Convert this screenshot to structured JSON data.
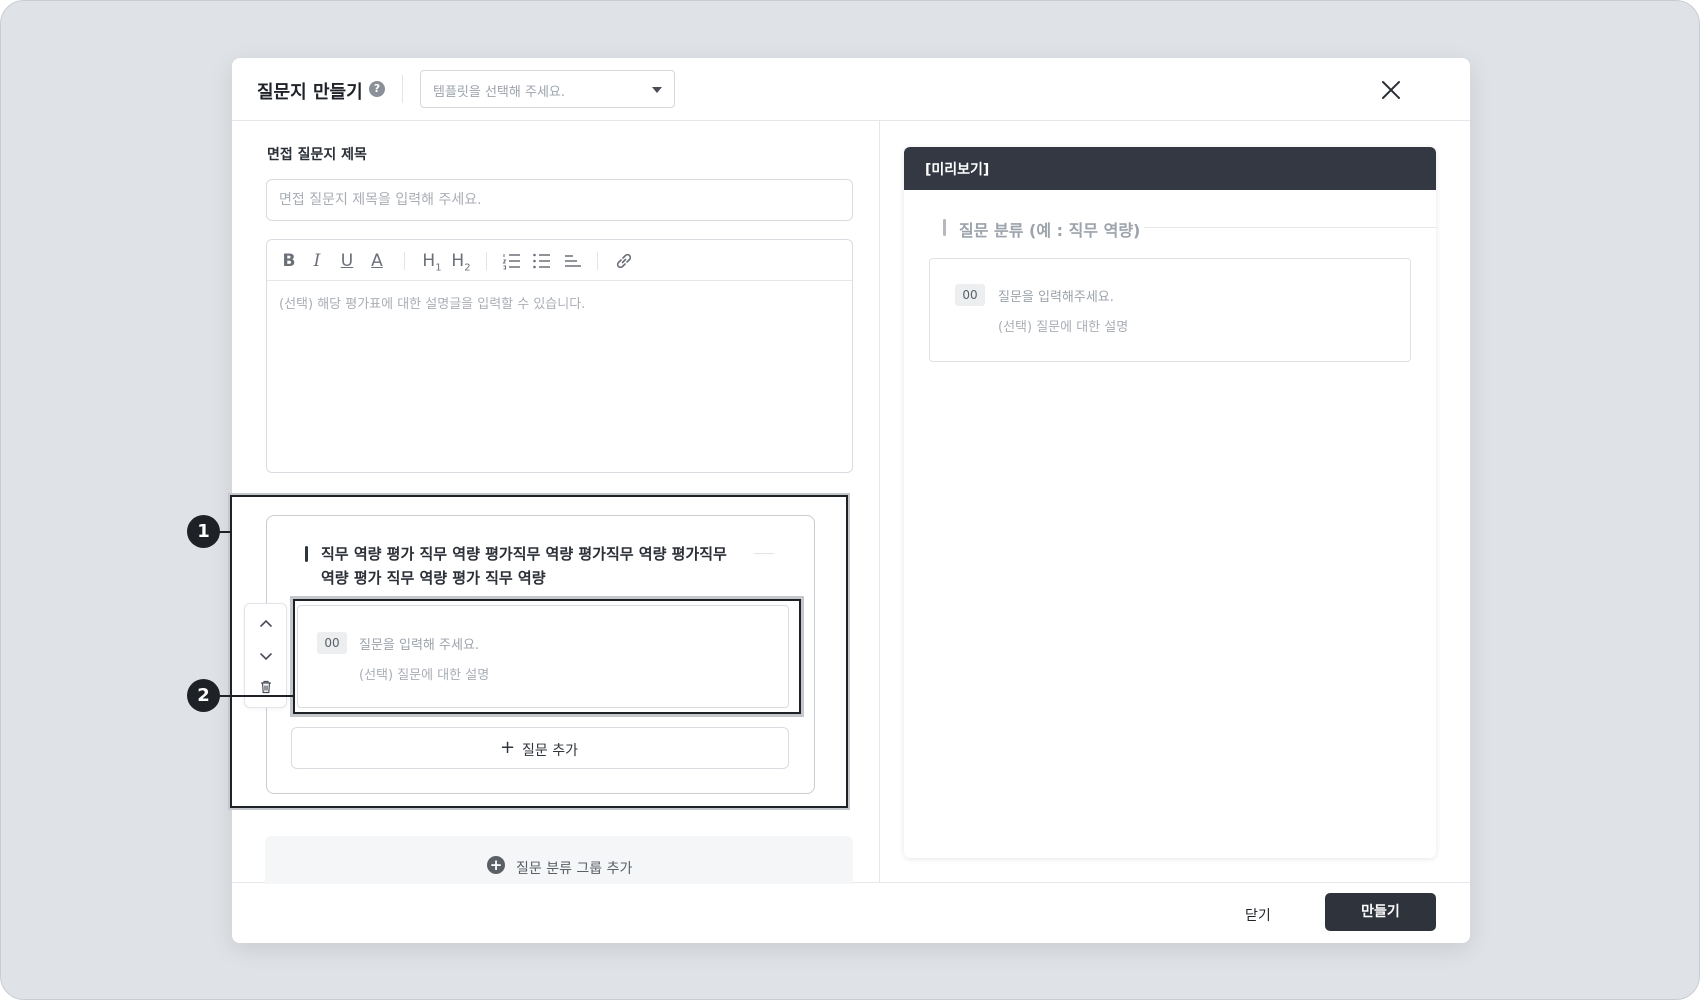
{
  "modal": {
    "title": "질문지 만들기",
    "help_icon": "?",
    "template_placeholder": "템플릿을 선택해 주세요."
  },
  "form": {
    "title_label": "면접 질문지 제목",
    "title_placeholder": "면접 질문지 제목을 입력해 주세요.",
    "editor_placeholder": "(선택) 해당 평가표에 대한 설명글을 입력할 수 있습니다.",
    "toolbar": {
      "bold": "B",
      "italic": "I",
      "underline": "U",
      "text_color": "A",
      "h1": "H",
      "h1_sub": "1",
      "h2": "H",
      "h2_sub": "2"
    }
  },
  "group": {
    "title": "직무 역량 평가 직무 역량 평가직무 역량 평가직무 역량 평가직무 역량 평가 직무 역량 평가 직무 역량",
    "question": {
      "number": "00",
      "placeholder": "질문을 입력해 주세요.",
      "description": "(선택) 질문에 대한 설명"
    },
    "add_question_label": "질문 추가",
    "add_question_plus": "+"
  },
  "add_group_label": "질문 분류 그룹 추가",
  "add_group_plus": "+",
  "markers": [
    "1",
    "2"
  ],
  "preview": {
    "header": "[미리보기]",
    "category": "질문 분류 (예 : 직무 역량)",
    "question_number": "00",
    "question_placeholder": "질문을 입력해주세요.",
    "question_description": "(선택) 질문에 대한 설명"
  },
  "footer": {
    "close_label": "닫기",
    "create_label": "만들기"
  },
  "colors": {
    "backdrop": "#dfe2e6",
    "primary_dark": "#2f333b",
    "preview_header": "#343842"
  },
  "icons": [
    "help-icon",
    "chevron-down-icon",
    "close-icon",
    "bold-icon",
    "italic-icon",
    "underline-icon",
    "text-color-icon",
    "heading1-icon",
    "heading2-icon",
    "ordered-list-icon",
    "bullet-list-icon",
    "align-icon",
    "link-icon",
    "arrow-up-icon",
    "arrow-down-icon",
    "trash-icon",
    "plus-icon",
    "plus-circle-icon"
  ]
}
